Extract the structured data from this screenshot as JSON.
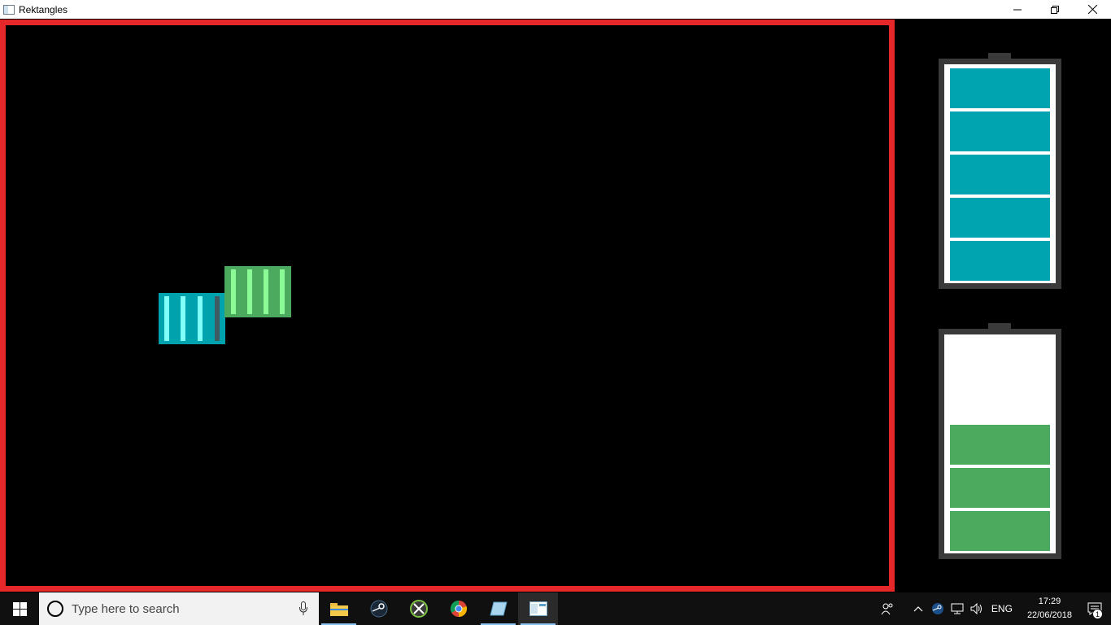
{
  "window": {
    "title": "Rektangles",
    "controls": {
      "minimize": "─",
      "restore": "❐",
      "close": "✕"
    }
  },
  "game": {
    "arena_border_color": "#e6282a",
    "players": [
      {
        "name": "cyan",
        "color": "#00a3ad",
        "stripe_color": "#7ffff8"
      },
      {
        "name": "green",
        "color": "#4caa5f",
        "stripe_color": "#8dfa98"
      }
    ],
    "batteries": [
      {
        "player": "cyan",
        "color": "#00a3b0",
        "filled_cells": 5,
        "total_cells": 5
      },
      {
        "player": "green",
        "color": "#4caa5f",
        "filled_cells": 3,
        "total_cells": 5
      }
    ]
  },
  "taskbar": {
    "search_placeholder": "Type here to search",
    "apps": [
      "file-explorer",
      "steam",
      "xbox",
      "chrome",
      "app-blue",
      "rektangles"
    ],
    "tray": {
      "language": "ENG",
      "time": "17:29",
      "date": "22/06/2018",
      "notification_count": "1"
    }
  }
}
